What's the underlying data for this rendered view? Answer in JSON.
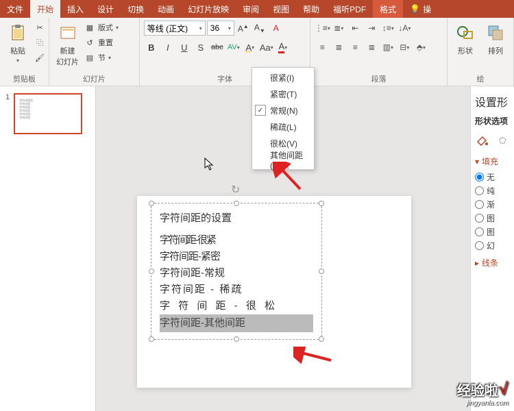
{
  "tabs": {
    "file": "文件",
    "home": "开始",
    "insert": "插入",
    "design": "设计",
    "transitions": "切换",
    "animations": "动画",
    "slideshow": "幻灯片放映",
    "review": "审阅",
    "view": "视图",
    "help": "帮助",
    "foxit": "福听PDF",
    "format": "格式",
    "tell": "操"
  },
  "ribbon": {
    "clipboard": {
      "title": "剪贴板",
      "paste": "粘贴"
    },
    "slides": {
      "title": "幻灯片",
      "new_slide": "新建\n幻灯片",
      "layout": "版式",
      "reset": "重置",
      "section": "节"
    },
    "font": {
      "title": "字体",
      "name": "等线 (正文)",
      "size": "36",
      "b": "B",
      "i": "I",
      "u": "U",
      "s": "S",
      "abc": "abc"
    },
    "paragraph": {
      "title": "段落"
    },
    "drawing": {
      "title": "绘",
      "shapes": "形状",
      "arrange": "排列"
    }
  },
  "spacing_menu": {
    "very_tight": "很紧(I)",
    "tight": "紧密(T)",
    "normal": "常规(N)",
    "loose": "稀疏(L)",
    "very_loose": "很松(V)",
    "more": "其他间距(M)..."
  },
  "slide": {
    "number": "1",
    "title": "字符间距的设置",
    "lines": [
      "字符间距-很紧",
      "字符间距-紧密",
      "字符间距-常规",
      "字符间距 - 稀疏",
      "字 符 间 距 - 很 松",
      "字符间距-其他间距"
    ]
  },
  "right_panel": {
    "title": "设置形",
    "sub": "形状选项",
    "fill_section": "填充",
    "line_section": "线条",
    "opts": {
      "none": "无",
      "solid": "纯",
      "gradient": "渐",
      "picture": "图",
      "pattern": "图",
      "slide_bg": "幻"
    }
  },
  "watermark": {
    "brand": "经验啦",
    "url": "jingyanla.com"
  }
}
